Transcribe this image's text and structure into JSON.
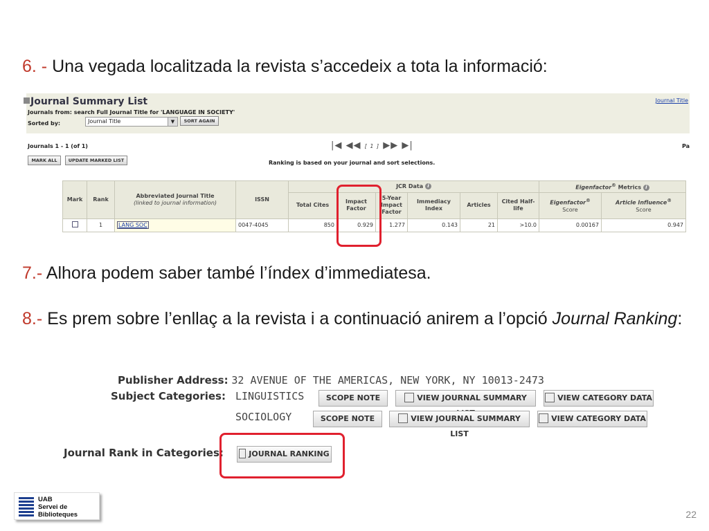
{
  "steps": {
    "step6": {
      "num": "6. -",
      "text": "Una vegada localitzada la revista s’accedeix a tota la informació:"
    },
    "step7": {
      "num": "7.-",
      "text": "Alhora podem saber també l’índex  d’immediatesa."
    },
    "step8": {
      "num": "8.-",
      "text_before": "Es prem sobre l’enllaç a la revista i a continuació anirem a l’opció ",
      "italic1": "Journal Ranking",
      "text_after": ":"
    }
  },
  "summary_list": {
    "title": "Journal Summary List",
    "top_link": "Journal Title",
    "journals_from": "Journals from:  search Full Journal Title for 'LANGUAGE IN SOCIETY'",
    "sorted_by_label": "Sorted by:",
    "sort_value": "Journal Title",
    "sort_again": "SORT AGAIN",
    "count": "Journals 1 - 1 (of 1)",
    "page_indicator": "[ 1 ]",
    "page_label": "Pa",
    "mark_all": "MARK ALL",
    "update_marked": "UPDATE MARKED LIST",
    "ranking_note": "Ranking is based on your journal and sort selections.",
    "headers": {
      "mark": "Mark",
      "rank": "Rank",
      "abbrev": "Abbreviated Journal Title",
      "abbrev_sub": "(linked to journal information)",
      "issn": "ISSN",
      "jcr_group": "JCR Data",
      "eigen_group_italic": "Eigenfactor",
      "eigen_group_sup": "®",
      "eigen_group_rest": " Metrics",
      "total_cites": "Total Cites",
      "impact_factor": "Impact Factor",
      "five_year": "5-Year Impact Factor",
      "immediacy": "Immediacy Index",
      "articles": "Articles",
      "cited_half_life": "Cited Half-life",
      "eigen_score": "Eigenfactor",
      "eigen_score_sup": "®",
      "eigen_score_sub": "Score",
      "article_influence": "Article Influence",
      "article_influence_sup": "®",
      "article_influence_sub": "Score"
    },
    "row": {
      "rank": "1",
      "abbrev": "LANG SOC",
      "issn": "0047-4045",
      "total_cites": "850",
      "impact_factor": "0.929",
      "five_year": "1.277",
      "immediacy": "0.143",
      "articles": "21",
      "cited_half_life": ">10.0",
      "eigen_score": "0.00167",
      "article_influence": "0.947"
    }
  },
  "publisher": {
    "address_label": "Publisher Address:",
    "address_value": "32 AVENUE OF THE AMERICAS, NEW YORK, NY 10013-2473",
    "subject_label": "Subject Categories:",
    "subjects": [
      {
        "name": "LINGUISTICS",
        "scope": "SCOPE NOTE",
        "summary": "VIEW JOURNAL SUMMARY LIST",
        "category": "VIEW CATEGORY DATA"
      },
      {
        "name": "SOCIOLOGY",
        "scope": "SCOPE NOTE",
        "summary": "VIEW JOURNAL SUMMARY LIST",
        "category": "VIEW CATEGORY DATA"
      }
    ],
    "rank_label": "Journal Rank in Categories:",
    "ranking_button": "JOURNAL RANKING"
  },
  "footer": {
    "logo_line1": "UAB",
    "logo_line2": "Servei de",
    "logo_line3": "Biblioteques",
    "page_number": "22"
  },
  "colors": {
    "step_number": "#c0392b",
    "highlight": "#e0202e",
    "link": "#1a3fa8"
  }
}
